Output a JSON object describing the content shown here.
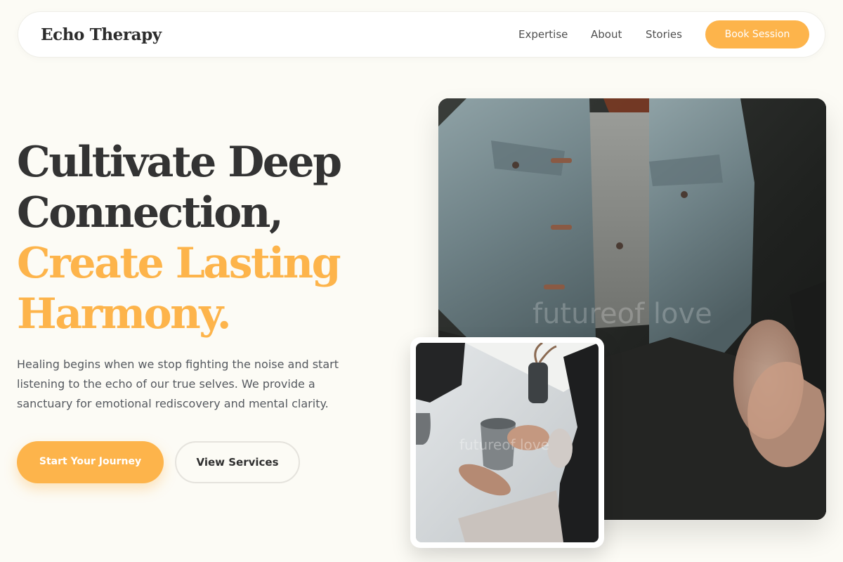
{
  "brand": "Echo Therapy",
  "nav": {
    "items": [
      {
        "label": "Expertise"
      },
      {
        "label": "About"
      },
      {
        "label": "Stories"
      }
    ],
    "cta": "Book Session"
  },
  "hero": {
    "headline_line1": "Cultivate Deep",
    "headline_line2": "Connection,",
    "headline_accent_line1": "Create Lasting",
    "headline_accent_line2": "Harmony.",
    "lead_line1": "Healing begins when we stop fighting the noise and start",
    "lead_line2": "listening to the echo of our true selves. We provide a",
    "lead_line3": "sanctuary for emotional rediscovery and mental clarity.",
    "primary_button": "Start Your Journey",
    "secondary_button": "View Services"
  },
  "images": {
    "main_watermark": "futureof love",
    "small_watermark": "futureof love"
  },
  "colors": {
    "accent": "#fdb44b",
    "background": "#fcfbf5",
    "heading": "#333333",
    "body_text": "#55595f"
  }
}
